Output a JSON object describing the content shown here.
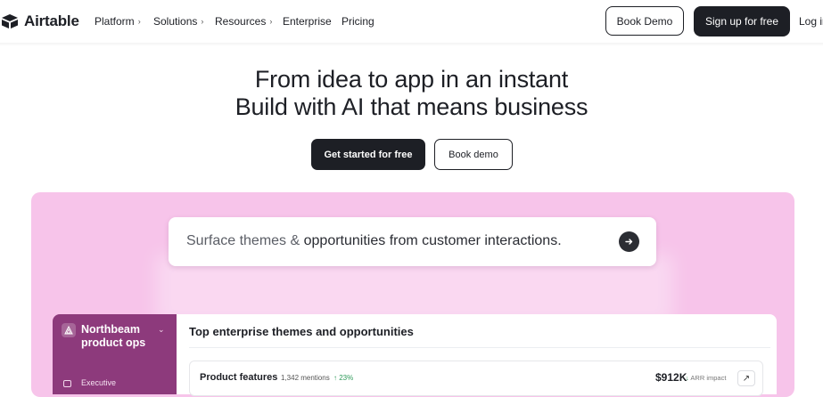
{
  "brand": {
    "name": "Airtable"
  },
  "nav": {
    "items": [
      {
        "label": "Platform",
        "has_chevron": true
      },
      {
        "label": "Solutions",
        "has_chevron": true
      },
      {
        "label": "Resources",
        "has_chevron": true
      },
      {
        "label": "Enterprise",
        "has_chevron": false
      },
      {
        "label": "Pricing",
        "has_chevron": false
      }
    ],
    "book_demo": "Book Demo",
    "signup": "Sign up for free",
    "login": "Log in"
  },
  "hero": {
    "line1": "From idea to app in an instant",
    "line2": "Build with AI that means business",
    "cta_primary": "Get started for free",
    "cta_secondary": "Book demo"
  },
  "prompt": {
    "part1": "Surface themes & ",
    "part2": "opportunities from customer interactions."
  },
  "app": {
    "workspace": "Northbeam product ops",
    "sidebar_item": "Executive",
    "title": "Top enterprise themes and opportunities",
    "row": {
      "name": "Product features",
      "mentions": "1,342 mentions",
      "growth": "23%",
      "value": "$912K",
      "impact": "ARR impact"
    }
  },
  "colors": {
    "accent_dark": "#1d1f25",
    "stage_pink": "#f7c4ea",
    "sidebar_plum": "#8d3a7c",
    "growth_green": "#2f9a5a"
  }
}
